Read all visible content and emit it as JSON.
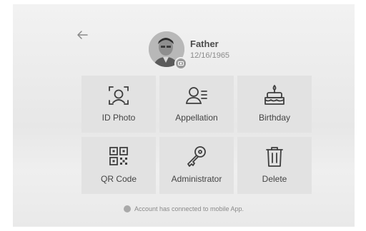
{
  "profile": {
    "name": "Father",
    "birthdate": "12/16/1965"
  },
  "tiles": [
    {
      "label": "ID Photo",
      "icon": "face-scan-icon"
    },
    {
      "label": "Appellation",
      "icon": "person-list-icon"
    },
    {
      "label": "Birthday",
      "icon": "birthday-cake-icon"
    },
    {
      "label": "QR Code",
      "icon": "qr-code-icon"
    },
    {
      "label": "Administrator",
      "icon": "key-icon"
    },
    {
      "label": "Delete",
      "icon": "trash-icon"
    }
  ],
  "footer": {
    "status_text": "Account has connected to mobile App."
  },
  "colors": {
    "background": "#ececec",
    "tile": "#e2e2e2",
    "icon": "#3f3f3f",
    "text": "#444444"
  }
}
